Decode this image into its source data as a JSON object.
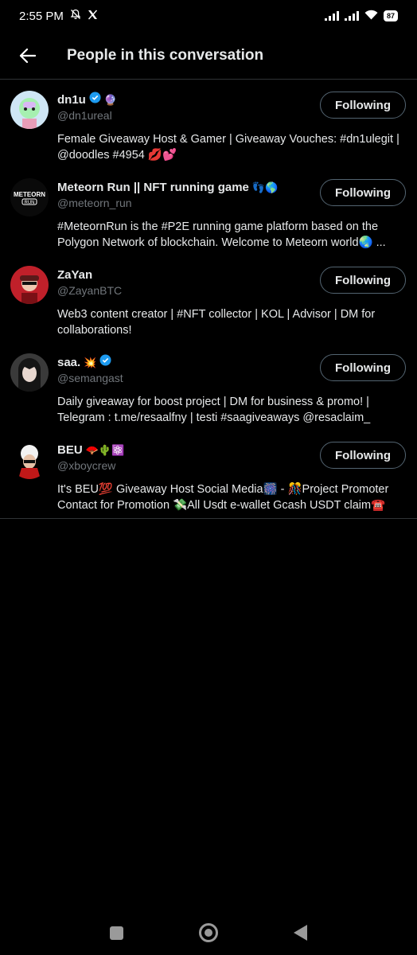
{
  "status_bar": {
    "time": "2:55 PM",
    "battery": "87"
  },
  "header": {
    "title": "People in this conversation"
  },
  "people": [
    {
      "name": "dn1u",
      "badges": "🔮",
      "handle": "@dn1ureal",
      "bio": "Female Giveaway Host & Gamer | Giveaway Vouches: #dn1ulegit | @doodles #4954 💋💕",
      "button": "Following"
    },
    {
      "name": "Meteorn Run || NFT running game",
      "badges": "👣🌎",
      "handle": "@meteorn_run",
      "bio": "#MeteornRun is the #P2E running game platform based on the Polygon Network of blockchain. Welcome to Meteorn world🌏 ...",
      "button": "Following"
    },
    {
      "name": "ZaYan",
      "badges": "",
      "handle": "@ZayanBTC",
      "bio": "Web3 content creator | #NFT collector | KOL | Advisor | DM for collaborations!",
      "button": "Following"
    },
    {
      "name": "saa.",
      "badges": "💥",
      "handle": "@semangast",
      "bio": "Daily giveaway for boost project | DM for business & promo! | Telegram : t.me/resaalfny | testi #saagiveaways @resaclaim_",
      "button": "Following"
    },
    {
      "name": "BEU",
      "badges": "🪭🌵⚛️",
      "handle": "@xboycrew",
      "bio": "It's BEU💯 Giveaway Host Social Media🎆 - 🎊Project Promoter Contact for Promotion 💸All Usdt e-wallet Gcash USDT claim☎️",
      "button": "Following"
    }
  ]
}
